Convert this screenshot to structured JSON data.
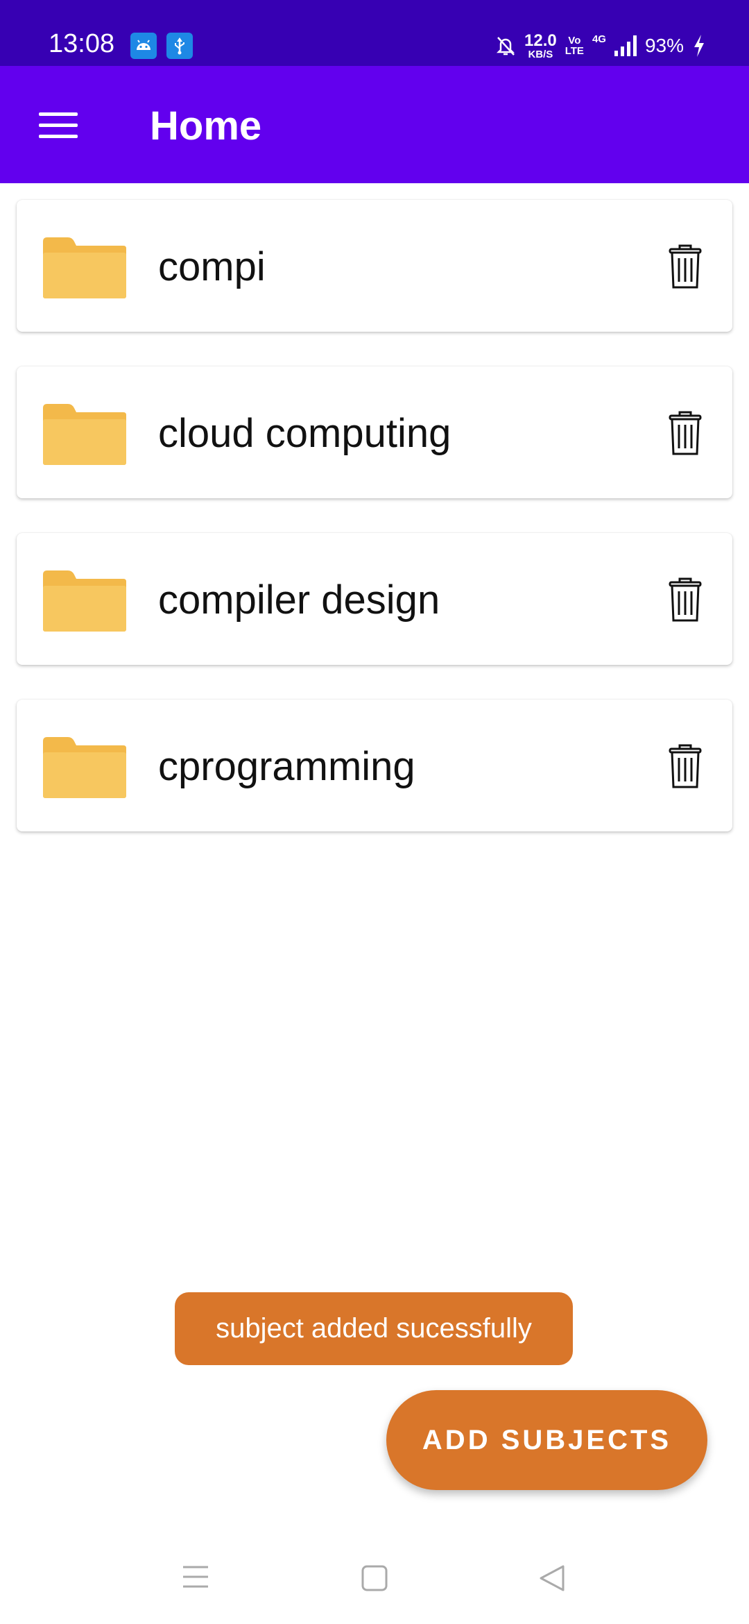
{
  "status_bar": {
    "time": "13:08",
    "net_speed_value": "12.0",
    "net_speed_unit": "KB/S",
    "volte_top": "Vo",
    "volte_bottom": "LTE",
    "network_type": "4G",
    "battery": "93%",
    "icons": [
      "android-icon",
      "usb-icon",
      "mute-bell-icon",
      "signal-icon",
      "charging-icon"
    ]
  },
  "app_bar": {
    "title": "Home",
    "menu_icon": "hamburger-menu-icon",
    "color": "#6200ee"
  },
  "subjects": [
    {
      "name": "compi"
    },
    {
      "name": "cloud computing"
    },
    {
      "name": "compiler design"
    },
    {
      "name": "cprogramming"
    }
  ],
  "toast": {
    "message": "subject added sucessfully"
  },
  "fab": {
    "label": "ADD SUBJECTS",
    "color": "#d9762a"
  },
  "nav_bar": {
    "icons": [
      "recent-apps-icon",
      "home-icon",
      "back-icon"
    ]
  },
  "colors": {
    "status_bar": "#3700b3",
    "folder": "#f7c75f",
    "accent": "#d9762a"
  }
}
